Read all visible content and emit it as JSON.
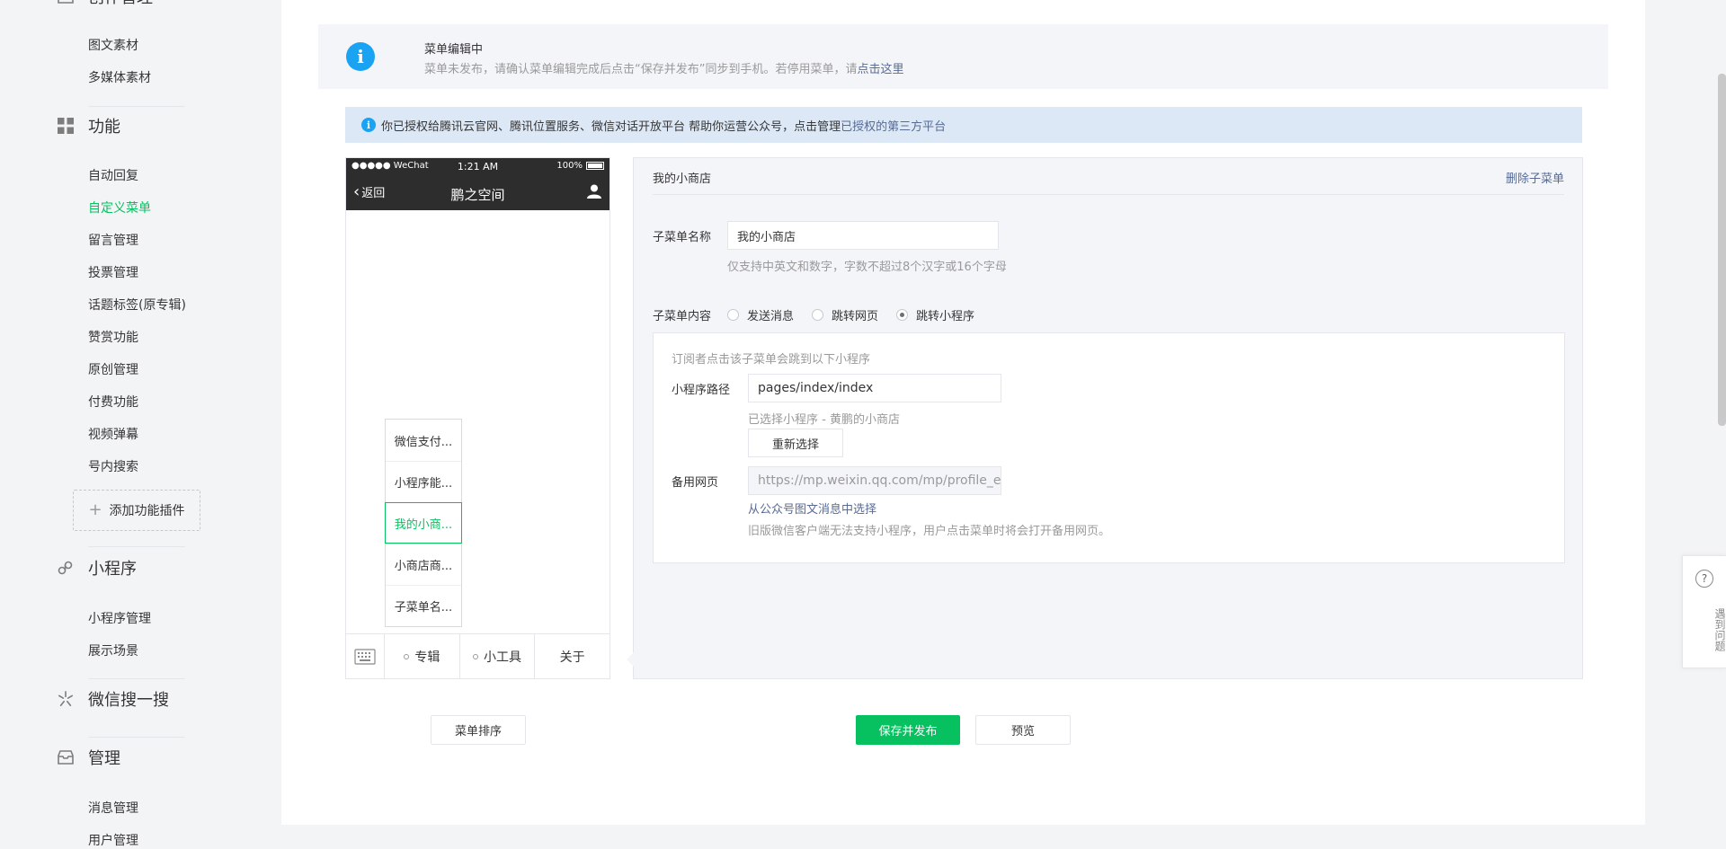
{
  "sidebar": {
    "creation": {
      "title": "创作管理",
      "items": [
        "图文素材",
        "多媒体素材"
      ]
    },
    "features": {
      "title": "功能",
      "items": [
        "自动回复",
        "自定义菜单",
        "留言管理",
        "投票管理",
        "话题标签(原专辑)",
        "赞赏功能",
        "原创管理",
        "付费功能",
        "视频弹幕",
        "号内搜索"
      ],
      "add_plugin": "添加功能插件"
    },
    "miniprogram": {
      "title": "小程序",
      "items": [
        "小程序管理",
        "展示场景"
      ]
    },
    "search": {
      "title": "微信搜一搜"
    },
    "manage": {
      "title": "管理",
      "items": [
        "消息管理",
        "用户管理"
      ]
    },
    "active_item": "自定义菜单",
    "active_color": "#07c160"
  },
  "notice": {
    "title": "菜单编辑中",
    "desc": "菜单未发布，请确认菜单编辑完成后点击“保存并发布”同步到手机。若停用菜单，请",
    "link": "点击这里"
  },
  "auth": {
    "text": "你已授权给腾讯云官网、腾讯位置服务、微信对话开放平台   帮助你运营公众号，点击管理",
    "link": "已授权的第三方平台"
  },
  "phone": {
    "carrier": "●●●●● WeChat",
    "time": "1:21 AM",
    "battery": "100%",
    "back": "返回",
    "title": "鹏之空间",
    "submenu": [
      "微信支付...",
      "小程序能...",
      "我的小商...",
      "小商店商...",
      "子菜单名..."
    ],
    "active_submenu": "我的小商...",
    "menu": [
      "专辑",
      "小工具",
      "关于"
    ]
  },
  "editor": {
    "header_title": "我的小商店",
    "delete_label": "删除子菜单",
    "name_label": "子菜单名称",
    "name_value": "我的小商店",
    "name_tip": "仅支持中英文和数字，字数不超过8个汉字或16个字母",
    "content_label": "子菜单内容",
    "options": [
      "发送消息",
      "跳转网页",
      "跳转小程序"
    ],
    "selected_option": "跳转小程序",
    "mp": {
      "intro": "订阅者点击该子菜单会跳到以下小程序",
      "path_label": "小程序路径",
      "path_value": "pages/index/index",
      "selected_tip": "已选择小程序 - 黄鹏的小商店",
      "reselect": "重新选择",
      "backup_label": "备用网页",
      "backup_value": "https://mp.weixin.qq.com/mp/profile_ext?action=home",
      "backup_link": "从公众号图文消息中选择",
      "backup_tip": "旧版微信客户端无法支持小程序，用户点击菜单时将会打开备用网页。"
    }
  },
  "actions": {
    "sort": "菜单排序",
    "save": "保存并发布",
    "preview": "预览"
  },
  "help": {
    "icon": "?",
    "label": "遇到问题"
  },
  "colors": {
    "primary": "#07c160",
    "link": "#576b95",
    "info": "#1aa2f3"
  }
}
